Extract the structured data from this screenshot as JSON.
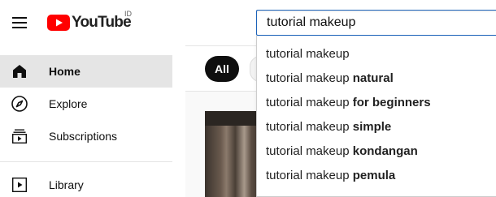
{
  "header": {
    "logo_text": "YouTube",
    "region": "ID",
    "logo_color": "#ff0000"
  },
  "search": {
    "value": "tutorial makeup"
  },
  "suggestions": [
    {
      "prefix": "tutorial makeup",
      "suffix": ""
    },
    {
      "prefix": "tutorial makeup ",
      "suffix": "natural"
    },
    {
      "prefix": "tutorial makeup ",
      "suffix": "for beginners"
    },
    {
      "prefix": "tutorial makeup ",
      "suffix": "simple"
    },
    {
      "prefix": "tutorial makeup ",
      "suffix": "kondangan"
    },
    {
      "prefix": "tutorial makeup ",
      "suffix": "pemula"
    }
  ],
  "sidebar": {
    "items": [
      {
        "label": "Home",
        "icon": "home-icon"
      },
      {
        "label": "Explore",
        "icon": "compass-icon"
      },
      {
        "label": "Subscriptions",
        "icon": "subscriptions-icon"
      },
      {
        "label": "Library",
        "icon": "library-icon"
      }
    ]
  },
  "chips": {
    "all_label": "All"
  }
}
